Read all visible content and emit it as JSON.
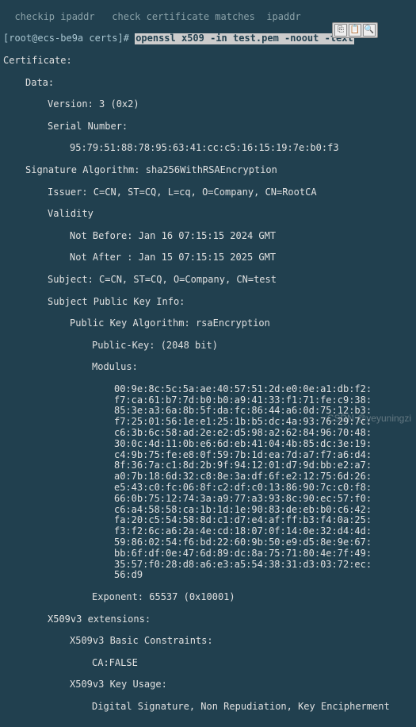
{
  "top_faded": "  checkip ipaddr   check certificate matches  ipaddr",
  "prompt": "[root@ecs-be9a certs]#",
  "command": "openssl x509 -in test.pem -noout -text",
  "cert": {
    "line_cert": "Certificate:",
    "line_data": "Data:",
    "version": "Version: 3 (0x2)",
    "serial_lbl": "Serial Number:",
    "serial_val": "95:79:51:88:78:95:63:41:cc:c5:16:15:19:7e:b0:f3",
    "sig_algo": "Signature Algorithm: sha256WithRSAEncryption",
    "issuer": "Issuer: C=CN, ST=CQ, L=cq, O=Company, CN=RootCA",
    "validity": "Validity",
    "not_before": "Not Before: Jan 16 07:15:15 2024 GMT",
    "not_after": "Not After : Jan 15 07:15:15 2025 GMT",
    "subject": "Subject: C=CN, ST=CQ, O=Company, CN=test",
    "spki": "Subject Public Key Info:",
    "pkalgo": "Public Key Algorithm: rsaEncryption",
    "pubkey": "Public-Key: (2048 bit)",
    "mod_lbl": "Modulus:",
    "mod": [
      "00:9e:8c:5c:5a:ae:40:57:51:2d:e0:0e:a1:db:f2:",
      "f7:ca:61:b7:7d:b0:b0:a9:41:33:f1:71:fe:c9:38:",
      "85:3e:a3:6a:8b:5f:da:fc:86:44:a6:0d:75:12:b3:",
      "f7:25:01:56:1e:e1:25:1b:b5:dc:4a:93:76:29:7c:",
      "c6:3b:6c:58:ad:2e:e2:d5:98:a2:62:84:96:70:48:",
      "30:0c:4d:11:0b:e6:6d:eb:41:04:4b:85:dc:3e:19:",
      "c4:9b:75:fe:e8:0f:59:7b:1d:ea:7d:a7:f7:a6:d4:",
      "8f:36:7a:c1:8d:2b:9f:94:12:01:d7:9d:bb:e2:a7:",
      "a0:7b:18:6d:32:c8:8e:3a:df:6f:e2:12:75:6d:26:",
      "e5:43:c0:fc:06:8f:c2:df:c0:13:86:90:7c:c0:f8:",
      "66:0b:75:12:74:3a:a9:77:a3:93:8c:90:ec:57:f0:",
      "c6:a4:58:58:ca:1b:1d:1e:90:83:de:eb:b0:c6:42:",
      "fa:20:c5:54:58:8d:c1:d7:e4:af:ff:b3:f4:0a:25:",
      "f3:f2:6c:a6:2a:4e:cd:18:07:0f:14:0e:32:d4:4d:",
      "59:86:02:54:f6:bd:22:60:9b:50:e9:d5:8e:9e:67:",
      "bb:6f:df:0e:47:6d:89:dc:8a:75:71:80:4e:7f:49:",
      "35:57:f0:28:d8:a6:e3:a5:54:38:31:d3:03:72:ec:",
      "56:d9"
    ],
    "exponent": "Exponent: 65537 (0x10001)",
    "ext_lbl": "X509v3 extensions:",
    "bc_lbl": "X509v3 Basic Constraints:",
    "bc_val": "CA:FALSE",
    "ku_lbl": "X509v3 Key Usage:",
    "ku_val": "Digital Signature, Non Repudiation, Key Encipherment"
  },
  "watermark": "CSDN @yeyuningzi",
  "icons": {
    "copy": "⎘",
    "paste": "📋",
    "search": "🔍"
  }
}
